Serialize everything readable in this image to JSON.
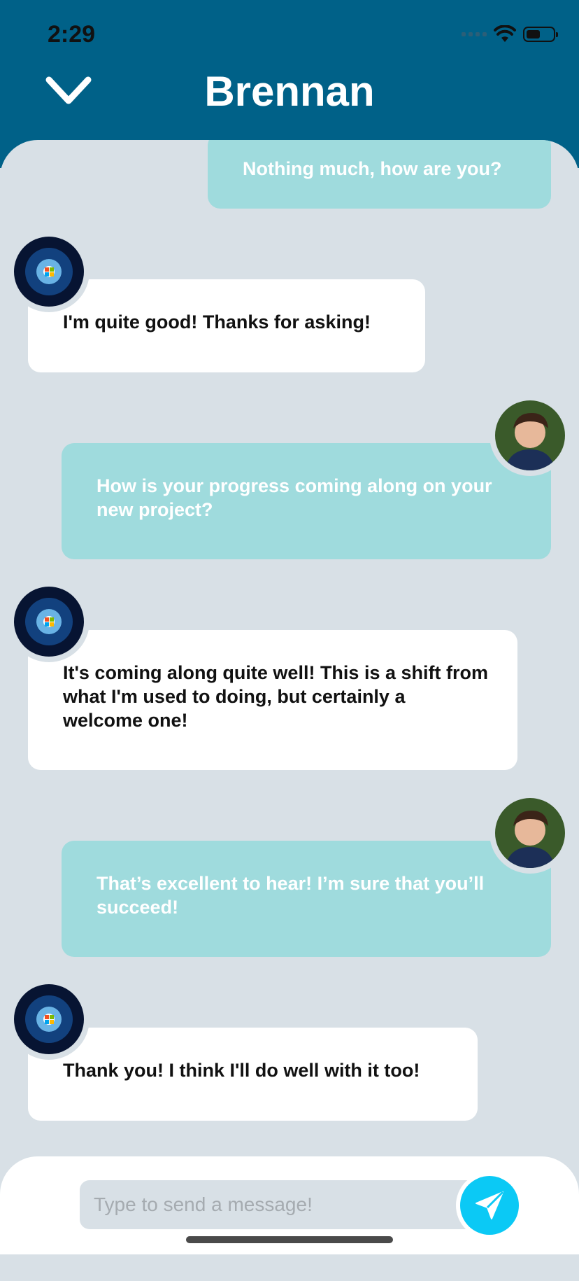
{
  "status": {
    "time": "2:29"
  },
  "header": {
    "title": "Brennan"
  },
  "messages": [
    {
      "dir": "out",
      "text": "Nothing much, how are you?"
    },
    {
      "dir": "in",
      "text": "I'm quite good! Thanks for asking!"
    },
    {
      "dir": "out",
      "text": "How is your progress coming along on your new project?"
    },
    {
      "dir": "in",
      "text": "It's coming along quite well! This is a shift from what I'm used to doing, but certainly a welcome one!"
    },
    {
      "dir": "out",
      "text": "That’s excellent to hear! I’m sure that you’ll succeed!"
    },
    {
      "dir": "in",
      "text": "Thank you! I think I'll do well with it too!"
    }
  ],
  "composer": {
    "placeholder": "Type to send a message!"
  },
  "colors": {
    "header": "#006188",
    "outgoing": "#9fdbdd",
    "incoming": "#ffffff",
    "send": "#0bc9f5",
    "background": "#d8e0e6"
  },
  "icons": {
    "back": "chevron-down-icon",
    "send": "paper-plane-icon"
  }
}
